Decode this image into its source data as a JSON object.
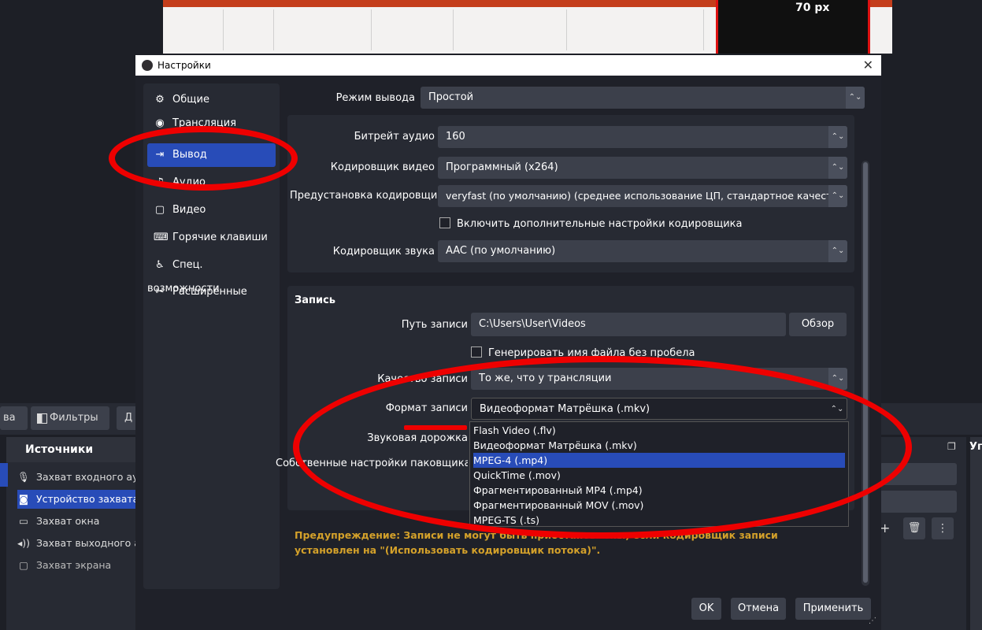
{
  "background": {
    "size_label": "70 px",
    "filters_button": "Фильтры",
    "toolbar_left_fragment": "ва",
    "toolbar_right_fragment": "Д",
    "sources_title": "Источники",
    "right_panel_fragment": "Уг",
    "sources": [
      {
        "label": "Захват входного ау",
        "icon": "microphone-icon"
      },
      {
        "label": "Устройство захвата",
        "icon": "camera-icon",
        "selected": true
      },
      {
        "label": "Захват окна",
        "icon": "window-icon"
      },
      {
        "label": "Захват выходного а",
        "icon": "speaker-icon"
      },
      {
        "label": "Захват экрана",
        "icon": "monitor-icon"
      }
    ]
  },
  "dialog": {
    "title": "Настройки",
    "close_glyph": "✕",
    "nav": [
      {
        "label": "Общие",
        "icon": "gear-icon"
      },
      {
        "label": "Трансляция",
        "icon": "broadcast-icon"
      },
      {
        "label": "Вывод",
        "icon": "output-icon",
        "active": true
      },
      {
        "label": "Аудио",
        "icon": "audio-icon"
      },
      {
        "label": "Видео",
        "icon": "video-icon"
      },
      {
        "label": "Горячие клавиши",
        "icon": "keyboard-icon"
      },
      {
        "label": "Спец. возможности",
        "icon": "accessibility-icon"
      },
      {
        "label": "Расширенные",
        "icon": "tools-icon"
      }
    ],
    "output_mode_label": "Режим вывода",
    "output_mode_value": "Простой",
    "streaming": {
      "audio_bitrate_label": "Битрейт аудио",
      "audio_bitrate_value": "160",
      "video_encoder_label": "Кодировщик видео",
      "video_encoder_value": "Программный (x264)",
      "encoder_preset_label": "Предустановка кодировщика",
      "encoder_preset_value": "veryfast (по умолчанию) (среднее использование ЦП, стандартное качество)",
      "advanced_encoder_checkbox": "Включить дополнительные настройки кодировщика",
      "audio_encoder_label": "Кодировщик звука",
      "audio_encoder_value": "AAC (по умолчанию)"
    },
    "recording": {
      "section_title": "Запись",
      "path_label": "Путь записи",
      "path_value": "C:\\Users\\User\\Videos",
      "browse_button": "Обзор",
      "no_space_checkbox": "Генерировать имя файла без пробела",
      "quality_label": "Качество записи",
      "quality_value": "То же, что у трансляции",
      "format_label": "Формат записи",
      "format_value": "Видеоформат Матрёшка (.mkv)",
      "audio_track_label": "Звуковая дорожка",
      "muxer_label": "Собственные настройки паковщика"
    },
    "format_options": [
      "Flash Video (.flv)",
      "Видеоформат Матрёшка (.mkv)",
      "MPEG-4 (.mp4)",
      "QuickTime (.mov)",
      "Фрагментированный MP4 (.mp4)",
      "Фрагментированный MOV (.mov)",
      "MPEG-TS (.ts)"
    ],
    "highlighted_option_index": 2,
    "warning": "Предупреждение: Записи не могут быть приостановлены, если кодировщик записи установлен на \"(Использовать кодировщик потока)\".",
    "buttons": {
      "ok": "OK",
      "cancel": "Отмена",
      "apply": "Применить"
    }
  },
  "colors": {
    "accent": "#284cb8",
    "annotation": "#ee0000",
    "warning": "#d4a12a"
  }
}
